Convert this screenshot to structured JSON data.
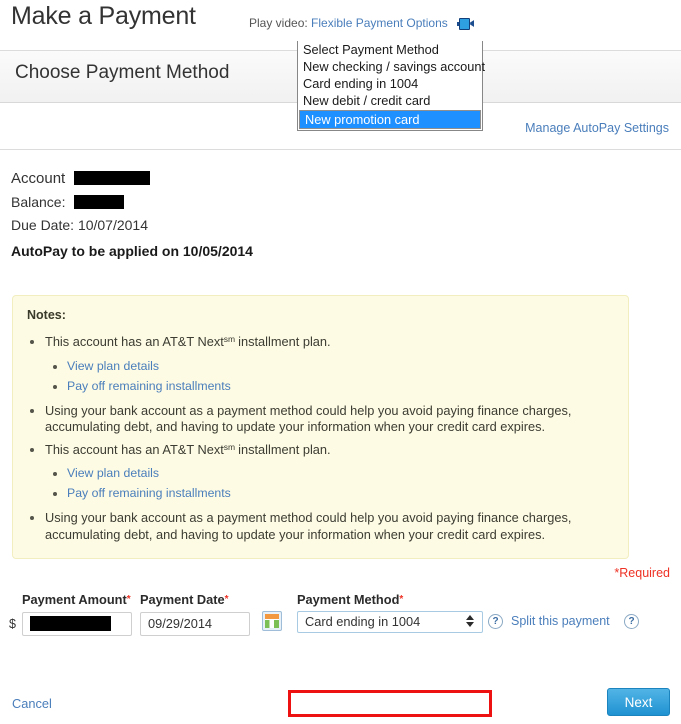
{
  "header": {
    "page_title": "Make a Payment",
    "play_video_label": "Play video:",
    "play_video_link": "Flexible Payment Options",
    "video_icon": "video-camera-icon"
  },
  "section": {
    "heading": "Choose Payment Method",
    "manage_autopay_link": "Manage AutoPay Settings"
  },
  "account": {
    "account_label": "Account",
    "account_value_redacted": true,
    "balance_label": "Balance:",
    "balance_value_redacted": true,
    "due_date_label": "Due Date:",
    "due_date_value": "10/07/2014",
    "autopay_notice": "AutoPay to be applied on 10/05/2014"
  },
  "notes": {
    "title": "Notes:",
    "items": [
      {
        "text_before": "This account has an AT&T Next",
        "superscript": "sm",
        "text_after": "installment plan.",
        "sublinks": [
          "View plan details",
          "Pay off remaining installments"
        ]
      },
      {
        "text": "Using your bank account as a payment method could help you avoid paying finance charges, accumulating debt, and having to update your information when your credit card expires."
      },
      {
        "text_before": "This account has an AT&T Next",
        "superscript": "sm",
        "text_after": "installment plan.",
        "sublinks": [
          "View plan details",
          "Pay off remaining installments"
        ]
      },
      {
        "text": "Using your bank account as a payment method could help you avoid paying finance charges, accumulating debt, and having to update your information when your credit card expires."
      }
    ],
    "background_color": "#fdfbe4",
    "border_color": "#f2eec0"
  },
  "form": {
    "required_note": "*Required",
    "required_note_color": "#ee3124",
    "amount": {
      "label": "Payment Amount",
      "required_marker": "*",
      "currency_symbol": "$",
      "value_redacted": true
    },
    "date": {
      "label": "Payment Date",
      "required_marker": "*",
      "value": "09/29/2014",
      "calendar_icon": "calendar-icon"
    },
    "method": {
      "label": "Payment Method",
      "required_marker": "*",
      "selected_value": "Card ending in 1004",
      "options": [
        "Select Payment Method",
        "New checking / savings account",
        "Card ending in 1004",
        "New debit / credit card",
        "New promotion card"
      ],
      "highlighted_option": "New promotion card",
      "highlight_color": "#1e90ff",
      "annotation_box_color": "#ee1111"
    },
    "help_icon_1": "help-question-icon",
    "help_icon_2": "help-question-icon",
    "split_payment_link": "Split this payment"
  },
  "footer": {
    "cancel_label": "Cancel",
    "next_label": "Next",
    "next_color": "#1f92d1"
  }
}
